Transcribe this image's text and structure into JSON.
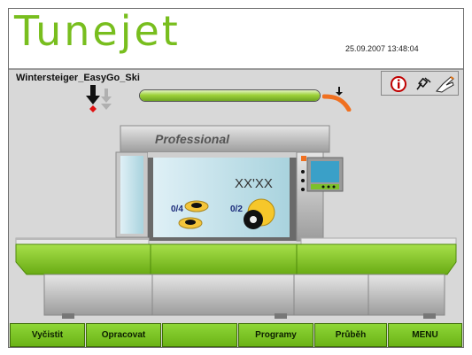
{
  "header": {
    "brand": "Tunejet",
    "datetime": "25.09.2007 13:48:04"
  },
  "machine": {
    "name": "Wintersteiger_EasyGo_Ski",
    "model_label": "Professional"
  },
  "process": {
    "progress_fraction": 1.0
  },
  "scene": {
    "display_text": "XX'XX",
    "counter_left": "0/4",
    "counter_right": "0/2"
  },
  "status_icons": [
    "info-icon",
    "plug-icon",
    "hand-pointer-icon"
  ],
  "colors": {
    "accent": "#7fc12b",
    "brand": "#78be1e",
    "panel": "#d8d8d8",
    "glass": "#bfe0e8"
  },
  "toolbar": {
    "buttons": [
      {
        "label": "Vyčistit"
      },
      {
        "label": "Opracovat"
      },
      {
        "label": ""
      },
      {
        "label": "Programy"
      },
      {
        "label": "Průběh"
      },
      {
        "label": "MENU"
      }
    ]
  }
}
